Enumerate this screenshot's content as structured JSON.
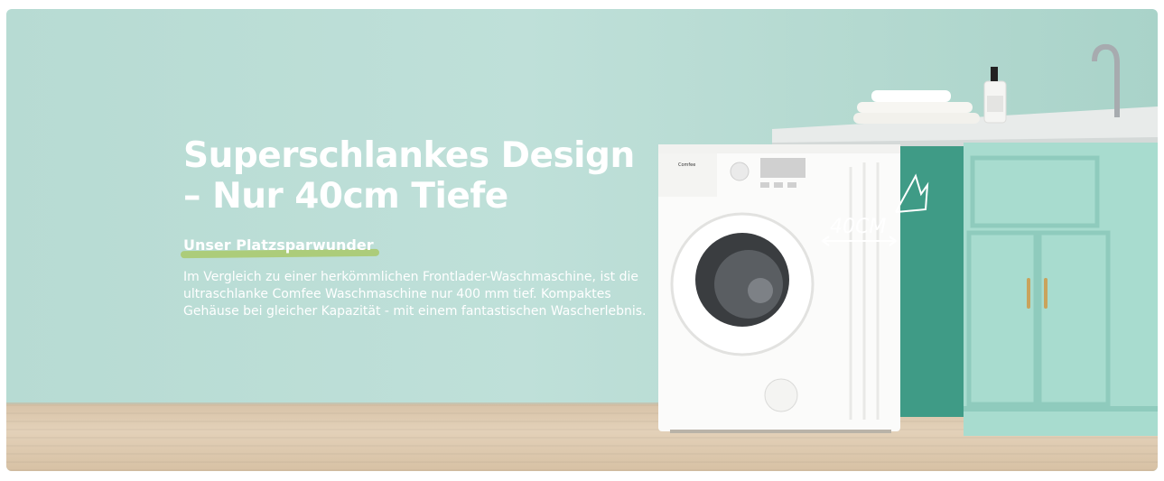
{
  "hero": {
    "headline_line1": "Superschlankes Design",
    "headline_line2": "– Nur 40cm Tiefe",
    "subheading": "Unser Platzsparwunder",
    "body": "Im Vergleich zu einer herkömmlichen Frontlader-Waschmaschine, ist die ultraschlanke Comfee Waschmaschine nur 400 mm tief. Kompaktes Gehäuse bei gleicher Kapazität - mit einem fantastischen Wascherlebnis."
  },
  "product": {
    "brand_label": "Comfee",
    "depth_annotation": "40CM"
  },
  "colors": {
    "wall": "#b7dbd3",
    "cabinet": "#a8dccf",
    "accent_underline": "#a9c96a",
    "text": "#ffffff"
  }
}
